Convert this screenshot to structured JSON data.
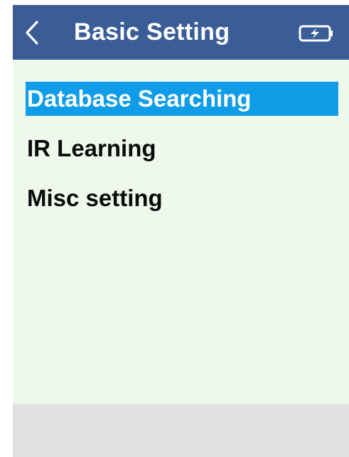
{
  "header": {
    "back_icon": "chevron-left-icon",
    "title": "Basic Setting",
    "battery_icon": "battery-charging-icon"
  },
  "menu": {
    "items": [
      {
        "label": "Database Searching",
        "selected": true
      },
      {
        "label": "IR Learning",
        "selected": false
      },
      {
        "label": "Misc setting",
        "selected": false
      }
    ]
  },
  "colors": {
    "header_bg": "#3a5d98",
    "screen_bg": "#eef9ec",
    "selection_bg": "#0e9de6",
    "selection_text": "#ffffff",
    "item_text": "#0a0a0a",
    "footer_bg": "#e1e1e1"
  }
}
